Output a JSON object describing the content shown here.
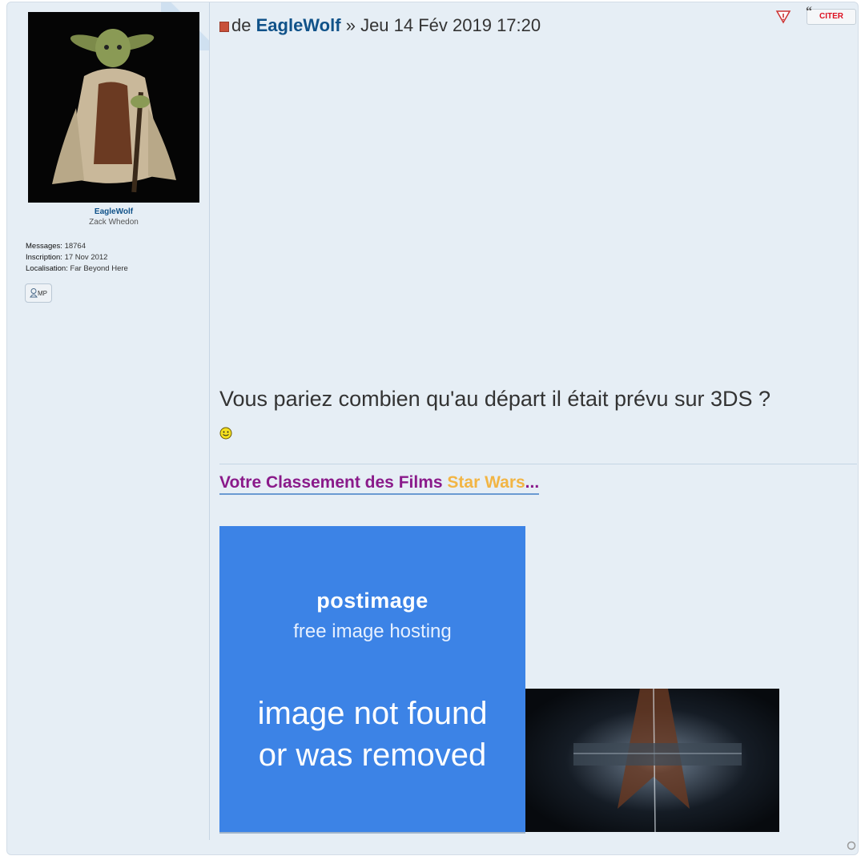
{
  "profile": {
    "username": "EagleWolf",
    "rank": "Zack Whedon",
    "stats": [
      {
        "label": "Messages:",
        "value": "18764"
      },
      {
        "label": "Inscription:",
        "value": "17 Nov 2012"
      },
      {
        "label": "Localisation:",
        "value": "Far Beyond Here"
      }
    ],
    "pm_label": "MP"
  },
  "post": {
    "prefix": "de",
    "author": "EagleWolf",
    "separator": "»",
    "date": "Jeu 14 Fév 2019 17:20",
    "quote_label": "CITER",
    "body": "Vous pariez combien qu'au départ il était prévu sur 3DS ?"
  },
  "signature": {
    "part1": "Votre Classement des Films",
    "part2": "Star Wars",
    "part3": "..."
  },
  "postimage": {
    "logo": "postimage",
    "tagline": "free image hosting",
    "message_line1": "image not found",
    "message_line2": "or was removed"
  },
  "colors": {
    "post_bg": "#e6eef5",
    "link": "#105289",
    "sig_purple": "#8a1a8a",
    "sig_gold": "#f2b544",
    "postimage_blue": "#3c83e6"
  }
}
